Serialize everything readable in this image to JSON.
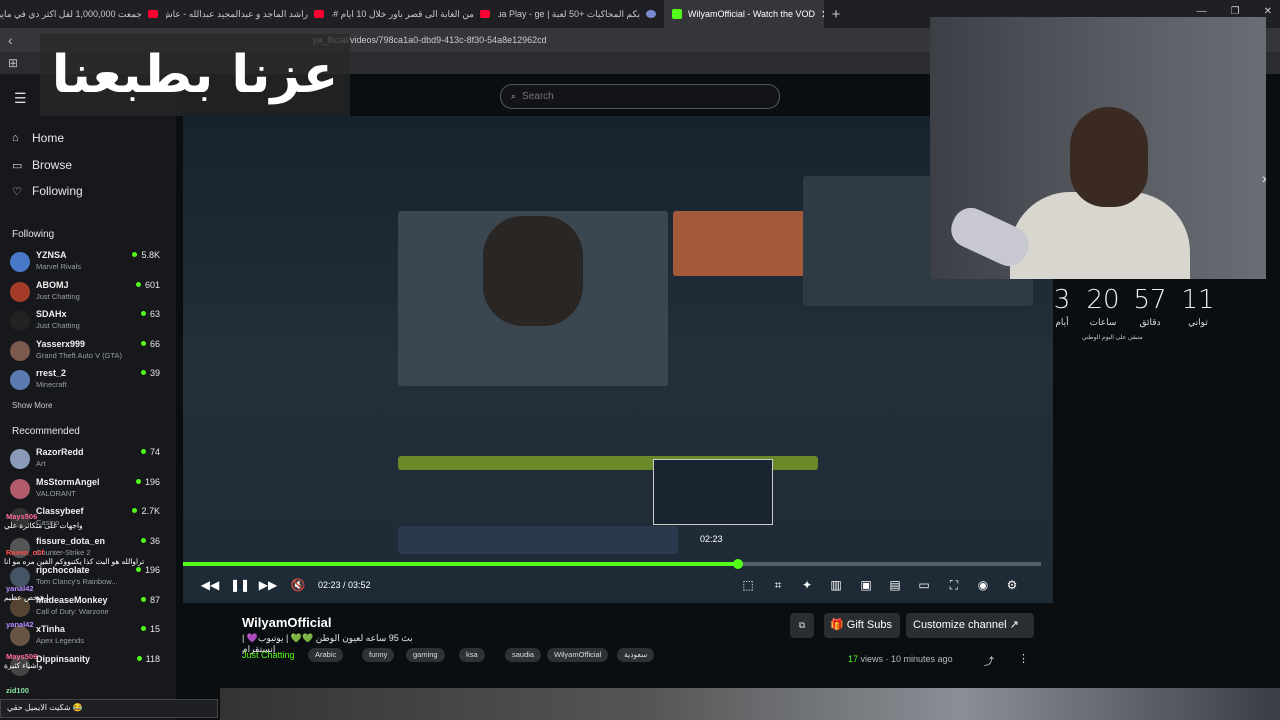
{
  "tabs": [
    {
      "title": "جمعت 1,000,000 لقل اكثر دي في ماين"
    },
    {
      "title": "راشد الماجد و عبدالمجيد عبدالله - عاش"
    },
    {
      "title": "من الغابة الى قصر باور خلال 10 ايام #4"
    },
    {
      "title": "بكم المحاكيات +50 لعبة | Lua Play - ge"
    },
    {
      "title": "WilyamOfficial - Watch the VOD"
    }
  ],
  "url": "ya_fficial/videos/798ca1a0-dbd9-413c-8f30-54a8e12962cd",
  "search": {
    "placeholder": "Search"
  },
  "overlay_title": "عزنا بطبعنا",
  "nav": {
    "home": "Home",
    "browse": "Browse",
    "following": "Following"
  },
  "following_header": "Following",
  "following": [
    {
      "name": "YZNSA",
      "game": "Marvel Rivals",
      "viewers": "5.8K",
      "color": "#4a78c8"
    },
    {
      "name": "ABOMJ",
      "game": "Just Chatting",
      "viewers": "601",
      "color": "#a33a2a"
    },
    {
      "name": "SDAHx",
      "game": "Just Chatting",
      "viewers": "63",
      "color": "#222222"
    },
    {
      "name": "Yasserx999",
      "game": "Grand Theft Auto V (GTA)",
      "viewers": "66",
      "color": "#7a5a4a"
    },
    {
      "name": "rrest_2",
      "game": "Minecraft",
      "viewers": "39",
      "color": "#5a7ab0"
    }
  ],
  "show_more": "Show More",
  "recommended_header": "Recommended",
  "recommended": [
    {
      "name": "RazorRedd",
      "game": "Art",
      "viewers": "74",
      "color": "#8a9ab8"
    },
    {
      "name": "MsStormAngel",
      "game": "VALORANT",
      "viewers": "196",
      "color": "#b05a6a"
    },
    {
      "name": "Classybeef",
      "game": "Casino",
      "viewers": "2.7K",
      "color": "#333333"
    },
    {
      "name": "fissure_dota_en",
      "game": "Counter-Strike 2",
      "viewers": "36",
      "color": "#555555"
    },
    {
      "name": "ripchocolate",
      "game": "Tom Clancy's Rainbow...",
      "viewers": "196",
      "color": "#445566"
    },
    {
      "name": "MadeaseMonkey",
      "game": "Call of Duty: Warzone",
      "viewers": "87",
      "color": "#554433"
    },
    {
      "name": "xTinha",
      "game": "Apex Legends",
      "viewers": "15",
      "color": "#665544"
    },
    {
      "name": "Dippinsanity",
      "game": "",
      "viewers": "118",
      "color": "#444444"
    }
  ],
  "countdown": [
    {
      "num": "3",
      "label": "أيام"
    },
    {
      "num": "20",
      "label": "ساعات"
    },
    {
      "num": "57",
      "label": "دقائق"
    },
    {
      "num": "11",
      "label": "ثواني"
    }
  ],
  "countdown_note": "متبقي على اليوم الوطني",
  "preview_time": "02:23",
  "player": {
    "time": "02:23 / 03:52",
    "progress": 0.6463
  },
  "video": {
    "channel": "WilyamOfficial",
    "title": "بث 95 ساعه لعيون الوطن 💚💚 | يوتيوب💜 | إنستقرام",
    "category": "Just Chatting",
    "tags": [
      "Arabic",
      "funny",
      "gaming",
      "ksa",
      "saudia",
      "WilyamOfficial",
      "سعودية"
    ],
    "views_count": "17",
    "views_label": " views",
    "ago": "10 minutes ago"
  },
  "buttons": {
    "gift": "Gift Subs",
    "customize": "Customize channel"
  },
  "chat": [
    {
      "user": "Mays506",
      "text": "واجهات على متكاثرة علي",
      "color": "#ff6b9a"
    },
    {
      "user": "Raven_osf",
      "text": "تراوالله هو البث كذا يكتبووكم القين مره مو انا",
      "color": "#ff4a4a"
    },
    {
      "user": "yanal42",
      "text": "يا شخص عظيم",
      "color": "#b98cff"
    },
    {
      "user": "yanal42",
      "text": "",
      "color": "#b98cff"
    },
    {
      "user": "Mays506",
      "text": "واشياء كثيرة",
      "color": "#ff6b9a"
    },
    {
      "user": "zid100",
      "text": "",
      "color": "#8ae0a0"
    }
  ],
  "chat_input": "شكيت الايميل حقي 😂",
  "colors": {
    "accent": "#53fc18",
    "bg": "#0b0e11",
    "sidebar": "#16181c"
  }
}
